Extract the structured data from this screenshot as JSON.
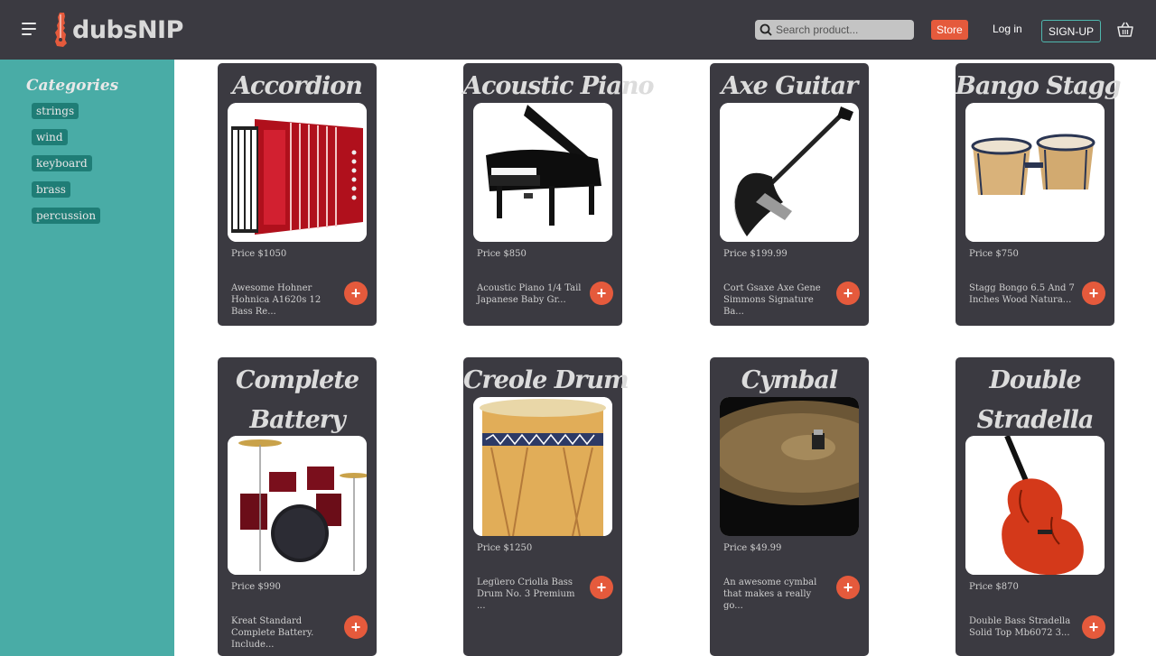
{
  "header": {
    "logo_text": "dubsNIP",
    "search_placeholder": "Search product...",
    "store_label": "Store",
    "login_label": "Log in",
    "signup_label": "SIGN-UP"
  },
  "sidebar": {
    "title": "Categories",
    "items": [
      {
        "label": "strings"
      },
      {
        "label": "wind"
      },
      {
        "label": "keyboard"
      },
      {
        "label": "brass"
      },
      {
        "label": "percussion"
      }
    ]
  },
  "products": [
    {
      "name": "Accordion",
      "price": "Price $1050",
      "desc": "Awesome Hohner Hohnica A1620s 12 Bass Re..."
    },
    {
      "name": "Acoustic Piano",
      "price": "Price $850",
      "desc": "Acoustic Piano 1/4 Tail Japanese Baby Gr..."
    },
    {
      "name": "Axe Guitar",
      "price": "Price $199.99",
      "desc": "Cort Gsaxe Axe Gene Simmons Signature Ba..."
    },
    {
      "name": "Bango Stagg",
      "price": "Price $750",
      "desc": "Stagg Bongo 6.5 And 7 Inches Wood Natura..."
    },
    {
      "name": "Complete Battery",
      "price": "Price $990",
      "desc": "Kreat Standard Complete Battery. Include..."
    },
    {
      "name": "Creole Drum",
      "price": "Price $1250",
      "desc": "Legüero Criolla Bass Drum No. 3 Premium ..."
    },
    {
      "name": "Cymbal",
      "price": "Price $49.99",
      "desc": "An awesome cymbal that makes a really go..."
    },
    {
      "name": "Double Stradella",
      "price": "Price $870",
      "desc": "Double Bass Stradella Solid Top Mb6072 3..."
    }
  ],
  "colors": {
    "navbar": "#3b3a41",
    "sidebar": "#49aca6",
    "accent": "#e55a3c",
    "category_pill": "#1f7d76"
  }
}
